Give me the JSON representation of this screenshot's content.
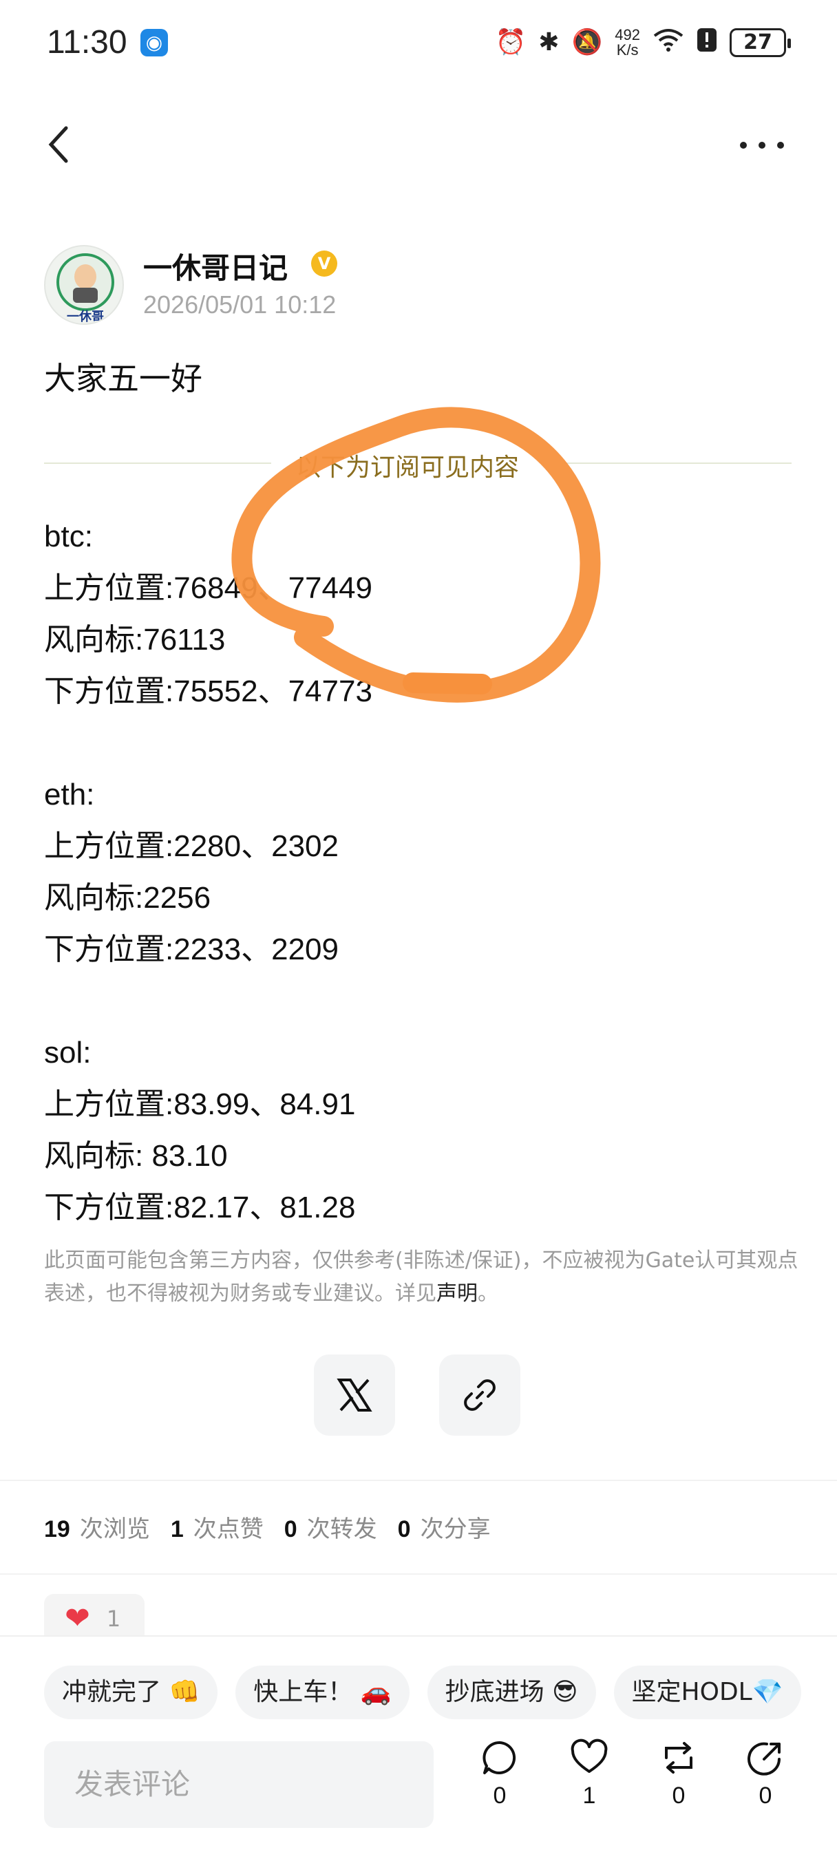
{
  "status_bar": {
    "time": "11:30",
    "net_speed_value": "492",
    "net_speed_unit": "K/s",
    "battery": "27"
  },
  "post": {
    "author": "一休哥日记",
    "avatar_caption": "一休哥",
    "datetime": "2026/05/01 10:12",
    "greeting": "大家五一好",
    "subscriber_divider": "以下为订阅可见内容",
    "lines": [
      "btc:",
      "上方位置:76849、77449",
      "风向标:76113",
      "下方位置:75552、74773",
      "",
      "eth:",
      "上方位置:2280、2302",
      "风向标:2256",
      "下方位置:2233、2209",
      "",
      "sol:",
      "上方位置:83.99、84.91",
      "风向标: 83.10",
      "下方位置:82.17、81.28"
    ],
    "disclaimer_text": "此页面可能包含第三方内容，仅供参考(非陈述/保证)，不应被视为Gate认可其观点表述，也不得被视为财务或专业建议。详见",
    "disclaimer_link": "声明",
    "disclaimer_end": "。"
  },
  "stats": {
    "views": "19",
    "views_label": "次浏览",
    "likes": "1",
    "likes_label": "次点赞",
    "reposts": "0",
    "reposts_label": "次转发",
    "shares": "0",
    "shares_label": "次分享"
  },
  "reaction": {
    "count": "1"
  },
  "quick_replies": [
    "冲就完了 👊",
    "快上车！ 🚗",
    "抄底进场 😎",
    "坚定HODL💎"
  ],
  "bottom": {
    "comment_placeholder": "发表评论",
    "comment_count": "0",
    "like_count": "1",
    "repost_count": "0",
    "share_count": "0"
  },
  "colors": {
    "annotation_orange": "#f7913d",
    "verified_gold": "#f5b91e",
    "heart_red": "#ea3a48"
  }
}
